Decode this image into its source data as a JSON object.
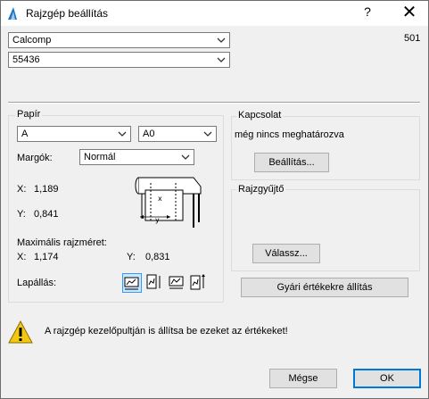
{
  "window": {
    "title": "Rajzgép beállítás",
    "help_glyph": "?",
    "close_glyph": "✕"
  },
  "plotter": {
    "model": "Calcomp",
    "variant": "55436",
    "number": "501"
  },
  "paper": {
    "group_title": "Papír",
    "size_series": "A",
    "size": "A0",
    "margins_label": "Margók:",
    "margins_value": "Normál",
    "x_label": "X:",
    "x_value": "1,189",
    "y_label": "Y:",
    "y_value": "0,841",
    "max_label": "Maximális rajzméret:",
    "max_x_label": "X:",
    "max_x_value": "1,174",
    "max_y_label": "Y:",
    "max_y_value": "0,831",
    "orientation_label": "Lapállás:",
    "diagram_y": "y",
    "diagram_x": "x"
  },
  "connection": {
    "group_title": "Kapcsolat",
    "status": "még nincs meghatározva",
    "settings_button": "Beállítás..."
  },
  "collector": {
    "group_title": "Rajzgyűjtő",
    "choose_button": "Válassz..."
  },
  "factory_button": "Gyári értékekre állítás",
  "warning": {
    "icon": "warning-icon",
    "text": "A rajzgép kezelőpultján is állítsa be ezeket az értékeket!"
  },
  "footer": {
    "cancel": "Mégse",
    "ok": "OK"
  },
  "colors": {
    "accent": "#0078d7",
    "warning": "#f2c811"
  }
}
